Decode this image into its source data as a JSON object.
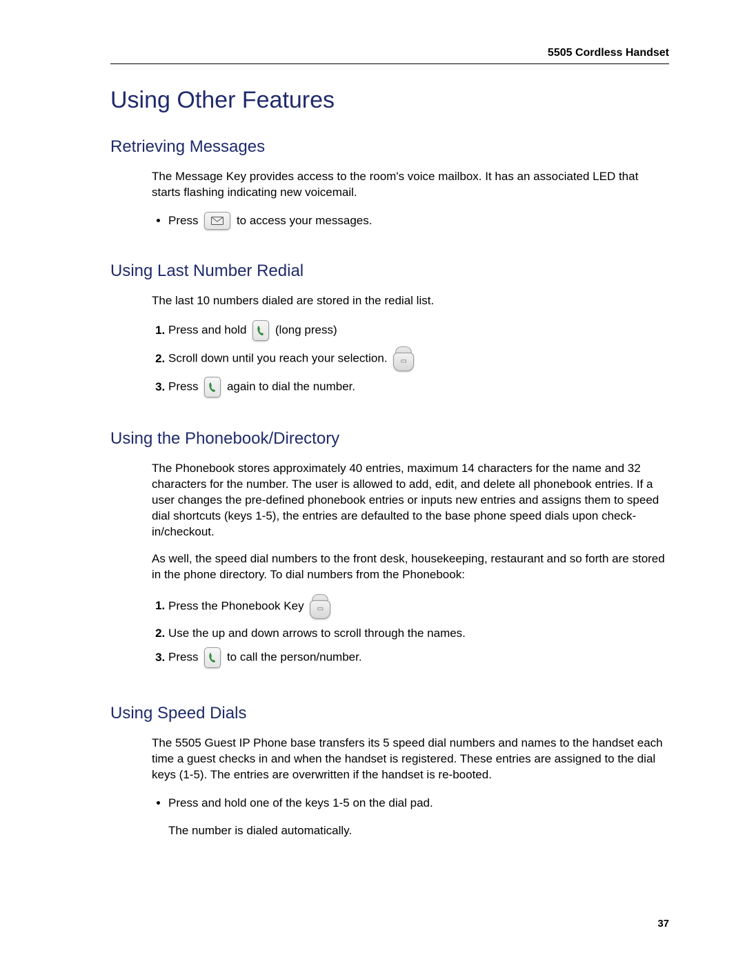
{
  "header": {
    "product": "5505 Cordless Handset"
  },
  "title": "Using Other Features",
  "sections": {
    "retrieving": {
      "heading": "Retrieving Messages",
      "para": "The Message Key provides access to the room's voice mailbox. It has an associated LED that starts flashing indicating new voicemail.",
      "bullet_pre": "Press",
      "bullet_post": "to access your messages."
    },
    "redial": {
      "heading": "Using Last Number Redial",
      "para": "The last 10 numbers dialed are stored in the redial list.",
      "step1_pre": "Press and hold",
      "step1_post": "(long press)",
      "step2": "Scroll down until you reach your selection.",
      "step3_pre": "Press",
      "step3_post": "again to dial the number."
    },
    "phonebook": {
      "heading": "Using the Phonebook/Directory",
      "para1": "The Phonebook stores approximately 40 entries, maximum 14 characters for the name and 32 characters for the number. The user is allowed to add, edit, and delete all phonebook entries. If a user changes the pre-defined phonebook entries or inputs new entries and assigns them to speed dial shortcuts (keys 1-5), the entries are defaulted to the base phone speed dials upon check-in/checkout.",
      "para2": "As well, the speed dial numbers to the front desk, housekeeping, restaurant and so forth are stored in the phone directory. To dial numbers from the Phonebook:",
      "step1": "Press the Phonebook Key",
      "step2": "Use the up and down arrows to scroll through the names.",
      "step3_pre": "Press",
      "step3_post": "to call the person/number."
    },
    "speeddial": {
      "heading": "Using Speed Dials",
      "para": "The 5505 Guest IP Phone base transfers its 5 speed dial numbers and names to the handset each time a guest checks in and when the handset is registered. These entries are assigned to the dial keys (1-5). The entries are overwritten if the handset is re-booted.",
      "bullet": "Press and hold one of the keys 1-5 on the dial pad.",
      "after": "The number is dialed automatically."
    }
  },
  "page_number": "37"
}
